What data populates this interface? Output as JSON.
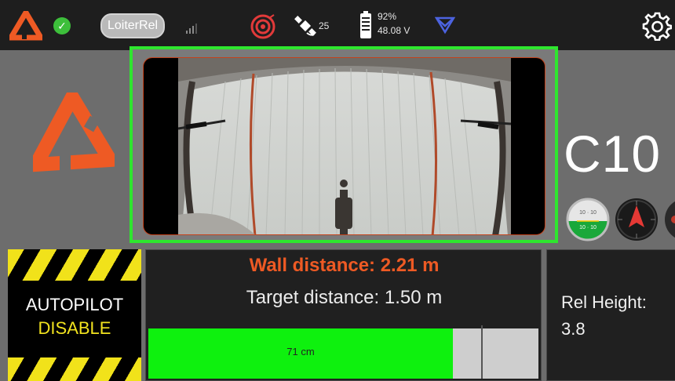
{
  "topbar": {
    "flight_mode": "LoiterRel",
    "satellite_count": "25",
    "battery_percent": "92%",
    "battery_voltage": "48.08 V"
  },
  "status": {
    "ok_badge": "✓"
  },
  "vehicle": {
    "identifier": "C10"
  },
  "autopilot": {
    "line1": "AUTOPILOT",
    "line2": "DISABLE"
  },
  "distance": {
    "wall_text": "Wall distance: 2.21 m",
    "target_text": "Target distance: 1.50 m",
    "bar_label": "71 cm",
    "bar_fill_fraction": 0.78,
    "bar_marker_fraction": 0.853
  },
  "rel_height": {
    "label": "Rel Height:",
    "value": "3.8"
  },
  "attitude_indicator": {
    "upper_ticks": "10 · 10",
    "lower_ticks": "10 · 10"
  },
  "colors": {
    "brand": "#ee5a24",
    "video_border": "#2ee62e",
    "bar_fill": "#0ef10e",
    "warning_stripe": "#f1e21a"
  },
  "icons": {
    "logo": "brand-delta-logo",
    "ok": "check-icon",
    "signal": "signal-bars-icon",
    "target": "target-icon",
    "satellite": "satellite-icon",
    "battery": "battery-icon",
    "link": "telemetry-link-icon",
    "settings": "gear-icon"
  }
}
